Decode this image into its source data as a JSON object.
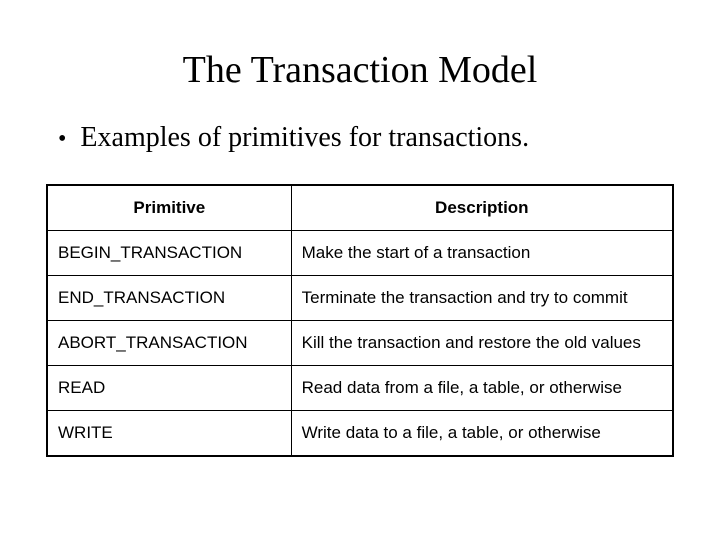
{
  "title": "The Transaction Model",
  "bullet": "Examples of primitives for transactions.",
  "table": {
    "headers": {
      "col1": "Primitive",
      "col2": "Description"
    },
    "rows": [
      {
        "primitive": "BEGIN_TRANSACTION",
        "description": "Make the start of a transaction"
      },
      {
        "primitive": "END_TRANSACTION",
        "description": "Terminate the transaction and try to commit"
      },
      {
        "primitive": "ABORT_TRANSACTION",
        "description": "Kill the transaction and restore the old values"
      },
      {
        "primitive": "READ",
        "description": "Read data from a file, a table, or otherwise"
      },
      {
        "primitive": "WRITE",
        "description": "Write data to a file, a table, or otherwise"
      }
    ]
  }
}
